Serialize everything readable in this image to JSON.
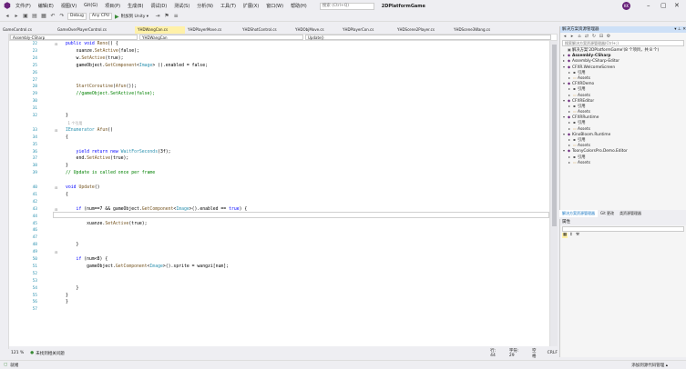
{
  "menubar": {
    "items": [
      "文件(F)",
      "编辑(E)",
      "视图(V)",
      "Git(G)",
      "项目(P)",
      "生成(B)",
      "调试(D)",
      "测试(S)",
      "分析(N)",
      "工具(T)",
      "扩展(X)",
      "窗口(W)",
      "帮助(H)"
    ],
    "search_placeholder": "搜索 (Ctrl+Q)",
    "title": "2DPlatformGame",
    "avatar": "KK"
  },
  "toolbar": {
    "config": "Debug",
    "platform": "Any CPU",
    "run_label": "附加到 Unity ▾"
  },
  "tabs": [
    "GameControl.cs",
    "GameOverPlayerControl.cs",
    "YHDWangCan.cs",
    "YHDPlayerMove.cs",
    "YHDShotControl.cs",
    "YHDObjMove.cs",
    "YHDPlayerCon.cs",
    "YHDScene2Player.cs",
    "YHDScene3Wang.cs"
  ],
  "nav": {
    "project": "Assembly-CSharp",
    "class": "YHDWangCan",
    "member": "Update()"
  },
  "code": [
    {
      "n": "22",
      "t": [
        [
          "kw",
          "public void "
        ],
        [
          "mt",
          "Reno"
        ],
        [
          "",
          "() {"
        ]
      ]
    },
    {
      "n": "23",
      "t": [
        [
          "",
          "    xuanze."
        ],
        [
          "mt",
          "SetActive"
        ],
        [
          "",
          "(false);"
        ]
      ]
    },
    {
      "n": "24",
      "t": [
        [
          "",
          "    w."
        ],
        [
          "mt",
          "SetActive"
        ],
        [
          "",
          "(true);"
        ]
      ]
    },
    {
      "n": "25",
      "t": [
        [
          "",
          "    gameObject."
        ],
        [
          "mt",
          "GetComponent"
        ],
        [
          "",
          "<"
        ],
        [
          "ty",
          "Image"
        ],
        [
          "",
          "> ().enabled = false;"
        ]
      ]
    },
    {
      "n": "26",
      "t": []
    },
    {
      "n": "27",
      "t": []
    },
    {
      "n": "28",
      "t": [
        [
          "",
          "    "
        ],
        [
          "mt",
          "StartCoroutine"
        ],
        [
          "",
          "("
        ],
        [
          "mt",
          "Afun"
        ],
        [
          "",
          "());"
        ]
      ]
    },
    {
      "n": "29",
      "t": [
        [
          "cm",
          "    //gameObject.SetActive(false);"
        ]
      ]
    },
    {
      "n": "30",
      "t": []
    },
    {
      "n": "31",
      "t": []
    },
    {
      "n": "32",
      "t": [
        [
          "",
          "}"
        ]
      ]
    },
    {
      "n": "",
      "t": [
        [
          "hint",
          "  1 个引用"
        ]
      ]
    },
    {
      "n": "33",
      "t": [
        [
          "ty",
          "IEnumerator "
        ],
        [
          "mt",
          "Afun"
        ],
        [
          "",
          "()"
        ]
      ]
    },
    {
      "n": "34",
      "t": [
        [
          "",
          "{"
        ]
      ]
    },
    {
      "n": "35",
      "t": []
    },
    {
      "n": "36",
      "t": [
        [
          "kw",
          "    yield return new "
        ],
        [
          "ty",
          "WaitForSeconds"
        ],
        [
          "",
          "(3f);"
        ]
      ]
    },
    {
      "n": "37",
      "t": [
        [
          "",
          "    end."
        ],
        [
          "mt",
          "SetActive"
        ],
        [
          "",
          "(true);"
        ]
      ]
    },
    {
      "n": "38",
      "t": [
        [
          "",
          "}"
        ]
      ]
    },
    {
      "n": "39",
      "t": [
        [
          "cm",
          "// Update is called once per frame"
        ]
      ]
    },
    {
      "n": "",
      "t": []
    },
    {
      "n": "40",
      "t": [
        [
          "kw",
          "void "
        ],
        [
          "mt",
          "Update"
        ],
        [
          "",
          "()"
        ]
      ]
    },
    {
      "n": "41",
      "t": [
        [
          "",
          "{"
        ]
      ]
    },
    {
      "n": "42",
      "t": []
    },
    {
      "n": "43",
      "t": [
        [
          "kw",
          "    if "
        ],
        [
          "",
          "(num==7 && gameObject."
        ],
        [
          "mt",
          "GetComponent"
        ],
        [
          "",
          "<"
        ],
        [
          "ty",
          "Image"
        ],
        [
          "",
          ">().enabled == "
        ],
        [
          "kw",
          "true"
        ],
        [
          "",
          ") {"
        ]
      ]
    },
    {
      "n": "44",
      "t": []
    },
    {
      "n": "45",
      "t": [
        [
          "",
          "        xuanze."
        ],
        [
          "mt",
          "SetActive"
        ],
        [
          "",
          "(true);"
        ]
      ]
    },
    {
      "n": "46",
      "t": []
    },
    {
      "n": "47",
      "t": []
    },
    {
      "n": "48",
      "t": [
        [
          "",
          "    }"
        ]
      ]
    },
    {
      "n": "49",
      "t": []
    },
    {
      "n": "50",
      "t": [
        [
          "kw",
          "    if "
        ],
        [
          "",
          "(num<8) {"
        ]
      ]
    },
    {
      "n": "51",
      "t": [
        [
          "",
          "        gameObject."
        ],
        [
          "mt",
          "GetComponent"
        ],
        [
          "",
          "<"
        ],
        [
          "ty",
          "Image"
        ],
        [
          "",
          ">().sprite = wangzi[num];"
        ]
      ]
    },
    {
      "n": "52",
      "t": []
    },
    {
      "n": "53",
      "t": []
    },
    {
      "n": "54",
      "t": [
        [
          "",
          "    }"
        ]
      ]
    },
    {
      "n": "55",
      "t": [
        [
          "",
          "}"
        ]
      ]
    },
    {
      "n": "56",
      "t": [
        [
          "",
          "}"
        ]
      ]
    },
    {
      "n": "57",
      "t": []
    }
  ],
  "editor_status": {
    "zoom": "121 %",
    "issues": "未找到相关问题",
    "line": "行: 44",
    "char": "字符: 29",
    "mode": "空格",
    "eol": "CRLF"
  },
  "solution": {
    "title": "解决方案资源管理器",
    "search_placeholder": "搜索解决方案资源管理器(Ctrl+;)",
    "nodes": [
      {
        "lvl": 0,
        "arrow": "",
        "icon": "▣",
        "label": "解决方案'2DPlatformGame'(8 个项目，共 8 个)"
      },
      {
        "lvl": 0,
        "arrow": "▸",
        "icon": "◆",
        "label": "Assembly-CSharp",
        "bold": true
      },
      {
        "lvl": 0,
        "arrow": "▸",
        "icon": "◆",
        "label": "Assembly-CSharp-Editor"
      },
      {
        "lvl": 0,
        "arrow": "▾",
        "icon": "◆",
        "label": "CFXR.WelcomeScreen"
      },
      {
        "lvl": 1,
        "arrow": "▸",
        "icon": "▪",
        "label": "引用"
      },
      {
        "lvl": 1,
        "arrow": "▸",
        "icon": "▭",
        "label": "Assets"
      },
      {
        "lvl": 0,
        "arrow": "▾",
        "icon": "◆",
        "label": "CFXRDemo"
      },
      {
        "lvl": 1,
        "arrow": "▸",
        "icon": "▪",
        "label": "引用"
      },
      {
        "lvl": 1,
        "arrow": "▸",
        "icon": "▭",
        "label": "Assets"
      },
      {
        "lvl": 0,
        "arrow": "▾",
        "icon": "◆",
        "label": "CFXREditor"
      },
      {
        "lvl": 1,
        "arrow": "▸",
        "icon": "▪",
        "label": "引用"
      },
      {
        "lvl": 1,
        "arrow": "▸",
        "icon": "▭",
        "label": "Assets"
      },
      {
        "lvl": 0,
        "arrow": "▾",
        "icon": "◆",
        "label": "CFXRRuntime"
      },
      {
        "lvl": 1,
        "arrow": "▸",
        "icon": "▪",
        "label": "引用"
      },
      {
        "lvl": 1,
        "arrow": "▸",
        "icon": "▭",
        "label": "Assets"
      },
      {
        "lvl": 0,
        "arrow": "▾",
        "icon": "◆",
        "label": "KinoBloom.Runtime"
      },
      {
        "lvl": 1,
        "arrow": "▸",
        "icon": "▪",
        "label": "引用"
      },
      {
        "lvl": 1,
        "arrow": "▸",
        "icon": "▭",
        "label": "Assets"
      },
      {
        "lvl": 0,
        "arrow": "▾",
        "icon": "◆",
        "label": "ToonyColorsPro.Demo.Editor"
      },
      {
        "lvl": 1,
        "arrow": "▸",
        "icon": "▪",
        "label": "引用"
      },
      {
        "lvl": 1,
        "arrow": "▸",
        "icon": "▭",
        "label": "Assets"
      }
    ],
    "tabs": [
      "解决方案资源管理器",
      "Git 更改",
      "类资源管理器"
    ]
  },
  "props": {
    "title": "属性"
  },
  "statusbar": {
    "left": "就绪",
    "right": "添加到源代码管理 ▴"
  }
}
